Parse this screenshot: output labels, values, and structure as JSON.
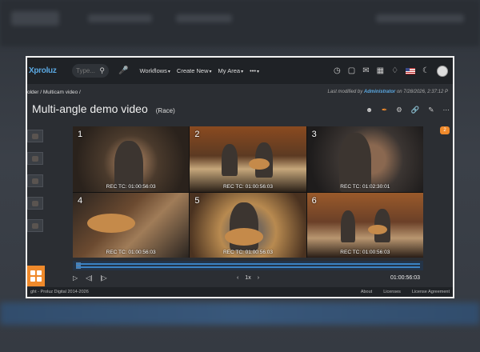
{
  "topbar": {
    "logo": "Xproluz",
    "search_placeholder": "Type...",
    "menus": [
      "Workflows",
      "Create New",
      "My Area",
      "•••"
    ]
  },
  "breadcrumb": {
    "parent": "older",
    "current": "Multicam video"
  },
  "modified": {
    "prefix": "Last modified by",
    "user": "Administrator",
    "suffix": "on 7/28/2026, 2:37:12 P"
  },
  "page": {
    "title": "Multi-angle demo video",
    "subtitle": "(Race)"
  },
  "badge": "2",
  "cameras": [
    {
      "num": "1",
      "tc": "REC TC: 01:00:56:03"
    },
    {
      "num": "2",
      "tc": "REC TC: 01:00:56:03"
    },
    {
      "num": "3",
      "tc": "REC TC: 01:02:30:01"
    },
    {
      "num": "4",
      "tc": "REC TC: 01:00:56:03"
    },
    {
      "num": "5",
      "tc": "REC TC: 01:00:56:03"
    },
    {
      "num": "6",
      "tc": "REC TC: 01:00:56:03"
    }
  ],
  "controls": {
    "speed": "1x",
    "duration": "01:00:56:03"
  },
  "footer": {
    "copyright": "ght - Proluz Digital 2014-2026",
    "links": [
      "About",
      "Licenses",
      "License Agreement"
    ]
  },
  "colors": {
    "accent": "#f08a2b",
    "link": "#5aa7e0",
    "timeline": "#3b82c4"
  }
}
